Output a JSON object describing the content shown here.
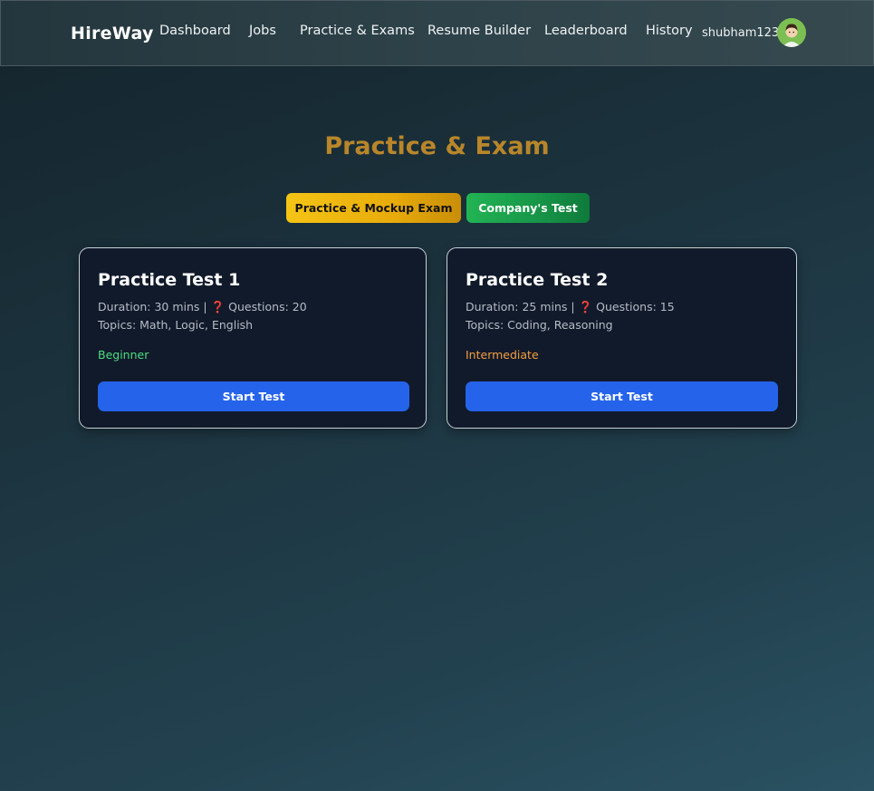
{
  "nav": {
    "brand": "HireWay",
    "links": [
      {
        "label": "Dashboard"
      },
      {
        "label": "Jobs"
      },
      {
        "label": "Practice & Exams"
      },
      {
        "label": "Resume Builder"
      },
      {
        "label": "Leaderboard"
      },
      {
        "label": "History"
      }
    ],
    "username": "shubham123",
    "avatar_icon": "user-avatar-icon"
  },
  "page": {
    "title": "Practice & Exam",
    "title_color": "#b8862a"
  },
  "tabs": [
    {
      "label": "Practice & Mockup Exam",
      "active": true
    },
    {
      "label": "Company's Test",
      "active": false
    }
  ],
  "cards": [
    {
      "title": "Practice Test 1",
      "duration": "Duration: 30 mins |",
      "question_icon": "❓",
      "questions": "Questions: 20",
      "topics": "Topics: Math, Logic, English",
      "level": "Beginner",
      "level_color": "#4ade80",
      "button_label": "Start Test"
    },
    {
      "title": "Practice Test 2",
      "duration": "Duration: 25 mins |",
      "question_icon": "❓",
      "questions": "Questions: 15",
      "topics": "Topics: Coding, Reasoning",
      "level": "Intermediate",
      "level_color": "#f59e42",
      "button_label": "Start Test"
    }
  ],
  "colors": {
    "accent_blue": "#2563eb",
    "tab_yellow": "#f5c415",
    "tab_green": "#22b454",
    "card_bg": "#111a2a"
  }
}
